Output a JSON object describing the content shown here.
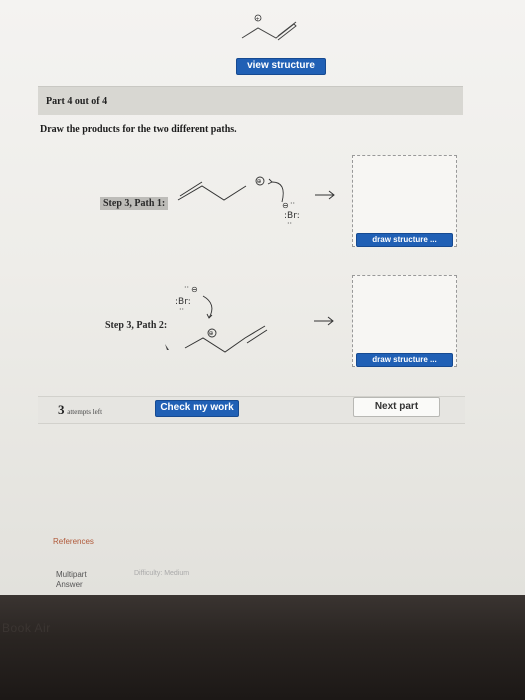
{
  "top": {
    "view_structure_label": "view structure"
  },
  "part": {
    "label": "Part 4 out of 4"
  },
  "instruction": "Draw the products for the two different paths.",
  "steps": [
    {
      "label": "Step 3, Path 1:",
      "draw_label": "draw structure ..."
    },
    {
      "label": "Step 3, Path 2:",
      "draw_label": "draw structure ..."
    }
  ],
  "mol": {
    "charge_symbol": "⊕",
    "anion_symbol": "⊖",
    "bromide": ":Br:",
    "dots": "··"
  },
  "footer": {
    "attempts_count": "3",
    "attempts_text": "attempts left",
    "check_label": "Check my work",
    "next_label": "Next part"
  },
  "bottom": {
    "references": "References",
    "multipart_line1": "Multipart",
    "multipart_line2": "Answer",
    "difficulty": "Difficulty: Medium",
    "bezel_text": "Book Air"
  },
  "colors": {
    "accent": "#2060b5",
    "references": "#b05a3a"
  }
}
